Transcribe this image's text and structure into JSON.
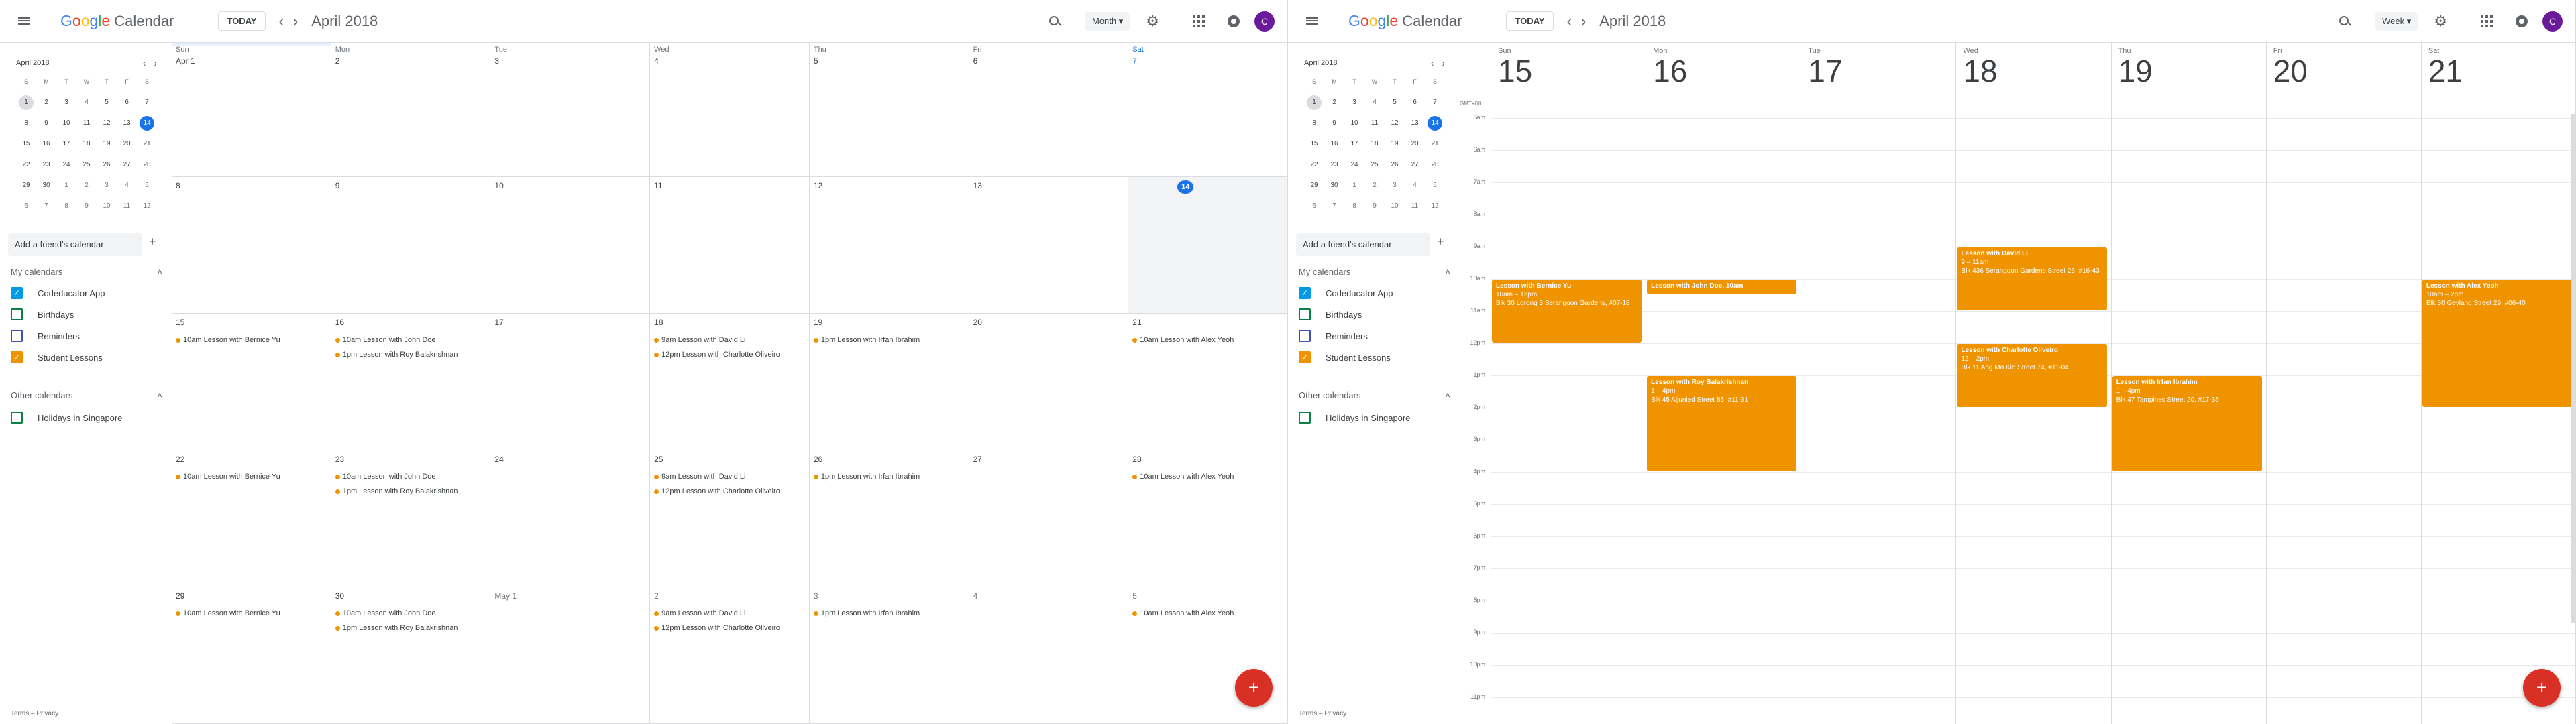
{
  "brand": {
    "google": "Google",
    "product": "Calendar"
  },
  "colors": {
    "primary": "#1a73e8",
    "event": "#f09300",
    "fab": "#d93025",
    "avatar": "#6a1b9a"
  },
  "icons": [
    "menu-icon",
    "search-icon",
    "settings-icon",
    "apps-icon",
    "notifications-icon",
    "add-icon"
  ],
  "panels": [
    {
      "id": "month",
      "today_label": "TODAY",
      "title": "April 2018",
      "view": "Month",
      "avatar": "C"
    },
    {
      "id": "week",
      "today_label": "TODAY",
      "title": "April 2018",
      "view": "Week",
      "avatar": "C"
    }
  ],
  "mini": {
    "title": "April 2018",
    "weekdays": [
      "S",
      "M",
      "T",
      "W",
      "T",
      "F",
      "S"
    ],
    "weeks": [
      [
        "1",
        "2",
        "3",
        "4",
        "5",
        "6",
        "7"
      ],
      [
        "8",
        "9",
        "10",
        "11",
        "12",
        "13",
        "14"
      ],
      [
        "15",
        "16",
        "17",
        "18",
        "19",
        "20",
        "21"
      ],
      [
        "22",
        "23",
        "24",
        "25",
        "26",
        "27",
        "28"
      ],
      [
        "29",
        "30",
        "1",
        "2",
        "3",
        "4",
        "5"
      ],
      [
        "6",
        "7",
        "8",
        "9",
        "10",
        "11",
        "12"
      ]
    ]
  },
  "friend_placeholder": "Add a friend's calendar",
  "my_calendars": {
    "label": "My calendars",
    "items": [
      {
        "name": "Codeducator App",
        "color": "#039be5",
        "checked": true
      },
      {
        "name": "Birthdays",
        "color": "#0b8043",
        "checked": false
      },
      {
        "name": "Reminders",
        "color": "#3f51b5",
        "checked": false
      },
      {
        "name": "Student Lessons",
        "color": "#f09300",
        "checked": true
      }
    ]
  },
  "other_calendars": {
    "label": "Other calendars",
    "items": [
      {
        "name": "Holidays in Singapore",
        "color": "#0b8043",
        "checked": false
      }
    ]
  },
  "footer": "Terms – Privacy",
  "month": {
    "day_names": [
      "Sun",
      "Mon",
      "Tue",
      "Wed",
      "Thu",
      "Fri",
      "Sat"
    ],
    "weeks": [
      [
        {
          "d": "Apr 1"
        },
        {
          "d": "2"
        },
        {
          "d": "3"
        },
        {
          "d": "4"
        },
        {
          "d": "5"
        },
        {
          "d": "6"
        },
        {
          "d": "7"
        }
      ],
      [
        {
          "d": "8"
        },
        {
          "d": "9"
        },
        {
          "d": "10"
        },
        {
          "d": "11"
        },
        {
          "d": "12"
        },
        {
          "d": "13"
        },
        {
          "d": "14",
          "today": true
        }
      ],
      [
        {
          "d": "15",
          "ev": [
            "10am Lesson with Bernice Yu"
          ]
        },
        {
          "d": "16",
          "ev": [
            "10am Lesson with John Doe",
            "1pm Lesson with Roy Balakrishnan"
          ]
        },
        {
          "d": "17"
        },
        {
          "d": "18",
          "ev": [
            "9am Lesson with David Li",
            "12pm Lesson with Charlotte Oliveiro"
          ]
        },
        {
          "d": "19",
          "ev": [
            "1pm Lesson with Irfan Ibrahim"
          ]
        },
        {
          "d": "20"
        },
        {
          "d": "21",
          "ev": [
            "10am Lesson with Alex Yeoh"
          ]
        }
      ],
      [
        {
          "d": "22",
          "ev": [
            "10am Lesson with Bernice Yu"
          ]
        },
        {
          "d": "23",
          "ev": [
            "10am Lesson with John Doe",
            "1pm Lesson with Roy Balakrishnan"
          ]
        },
        {
          "d": "24"
        },
        {
          "d": "25",
          "ev": [
            "9am Lesson with David Li",
            "12pm Lesson with Charlotte Oliveiro"
          ]
        },
        {
          "d": "26",
          "ev": [
            "1pm Lesson with Irfan Ibrahim"
          ]
        },
        {
          "d": "27"
        },
        {
          "d": "28",
          "ev": [
            "10am Lesson with Alex Yeoh"
          ]
        }
      ],
      [
        {
          "d": "29",
          "ev": [
            "10am Lesson with Bernice Yu"
          ]
        },
        {
          "d": "30",
          "ev": [
            "10am Lesson with John Doe",
            "1pm Lesson with Roy Balakrishnan"
          ]
        },
        {
          "d": "May 1",
          "om": true
        },
        {
          "d": "2",
          "om": true,
          "ev": [
            "9am Lesson with David Li",
            "12pm Lesson with Charlotte Oliveiro"
          ]
        },
        {
          "d": "3",
          "om": true,
          "ev": [
            "1pm Lesson with Irfan Ibrahim"
          ]
        },
        {
          "d": "4",
          "om": true
        },
        {
          "d": "5",
          "om": true,
          "ev": [
            "10am Lesson with Alex Yeoh"
          ]
        }
      ]
    ]
  },
  "week": {
    "timezone": "GMT+08",
    "days": [
      {
        "n": "Sun",
        "d": "15"
      },
      {
        "n": "Mon",
        "d": "16"
      },
      {
        "n": "Tue",
        "d": "17"
      },
      {
        "n": "Wed",
        "d": "18"
      },
      {
        "n": "Thu",
        "d": "19"
      },
      {
        "n": "Fri",
        "d": "20"
      },
      {
        "n": "Sat",
        "d": "21"
      }
    ],
    "hours": [
      "5am",
      "6am",
      "7am",
      "8am",
      "9am",
      "10am",
      "11am",
      "12pm",
      "1pm",
      "2pm",
      "3pm",
      "4pm",
      "5pm",
      "6pm",
      "7pm",
      "8pm",
      "9pm",
      "10pm",
      "11pm"
    ],
    "events": [
      {
        "day": 0,
        "start": 10,
        "end": 12,
        "title": "Lesson with Bernice Yu",
        "time": "10am – 12pm",
        "loc": "Blk 30 Lorong 3 Serangoon Gardens, #07-18"
      },
      {
        "day": 1,
        "start": 10,
        "end": 10.5,
        "title": "Lesson with John Doe, 10am",
        "time": "",
        "loc": ""
      },
      {
        "day": 1,
        "start": 13,
        "end": 16,
        "title": "Lesson with Roy Balakrishnan",
        "time": "1 – 4pm",
        "loc": "Blk 45 Aljunied Street 85, #11-31"
      },
      {
        "day": 3,
        "start": 9,
        "end": 11,
        "title": "Lesson with David Li",
        "time": "9 – 11am",
        "loc": "Blk 436 Serangoon Gardens Street 26, #16-43"
      },
      {
        "day": 3,
        "start": 12,
        "end": 14,
        "title": "Lesson with Charlotte Oliveiro",
        "time": "12 – 2pm",
        "loc": "Blk 11 Ang Mo Kio Street 74, #11-04"
      },
      {
        "day": 4,
        "start": 13,
        "end": 16,
        "title": "Lesson with Irfan Ibrahim",
        "time": "1 – 4pm",
        "loc": "Blk 47 Tampines Street 20, #17-35"
      },
      {
        "day": 6,
        "start": 10,
        "end": 14,
        "title": "Lesson with Alex Yeoh",
        "time": "10am – 2pm",
        "loc": "Blk 30 Geylang Street 29, #06-40"
      }
    ]
  }
}
